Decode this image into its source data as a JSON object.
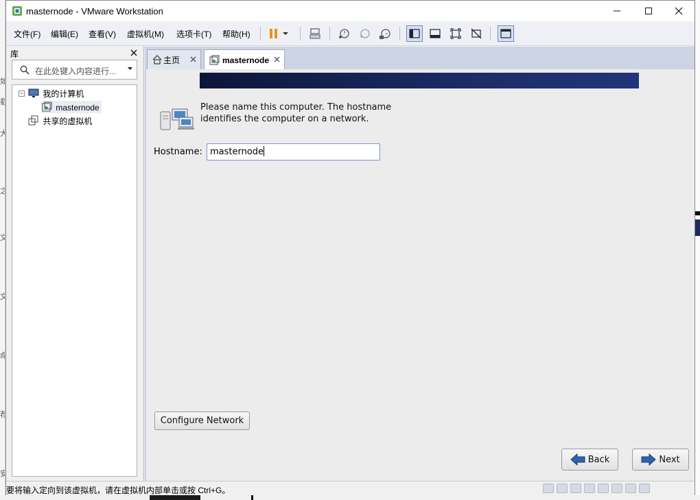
{
  "window": {
    "title": "masternode - VMware Workstation"
  },
  "menu": {
    "items": [
      "文件(F)",
      "编辑(E)",
      "查看(V)",
      "虚拟机(M)",
      "选项卡(T)",
      "帮助(H)"
    ]
  },
  "toolbar": {
    "icons": [
      "pause-icon",
      "send-keys-icon",
      "snapshot-take-icon",
      "snapshot-revert-icon",
      "snapshot-manager-icon",
      "library-view-icon",
      "thumbnail-view-icon",
      "fullscreen-icon",
      "unity-icon",
      "console-view-icon"
    ],
    "accent": "#e8941a"
  },
  "library": {
    "title": "库",
    "search_placeholder": "在此处键入内容进行...",
    "tree": {
      "root_label": "我的计算机",
      "vm_label": "masternode",
      "shared_label": "共享的虚拟机"
    }
  },
  "tabs": [
    {
      "label": "主页"
    },
    {
      "label": "masternode"
    }
  ],
  "guest": {
    "message": "Please name this computer.  The hostname identifies the computer on a network.",
    "hostname_label": "Hostname:",
    "hostname_value": "masternode",
    "configure_network_label": "Configure Network",
    "back_label": "Back",
    "next_label": "Next"
  },
  "status": {
    "text": "要将输入定向到该虚拟机，请在虚拟机内部单击或按 Ctrl+G。"
  }
}
